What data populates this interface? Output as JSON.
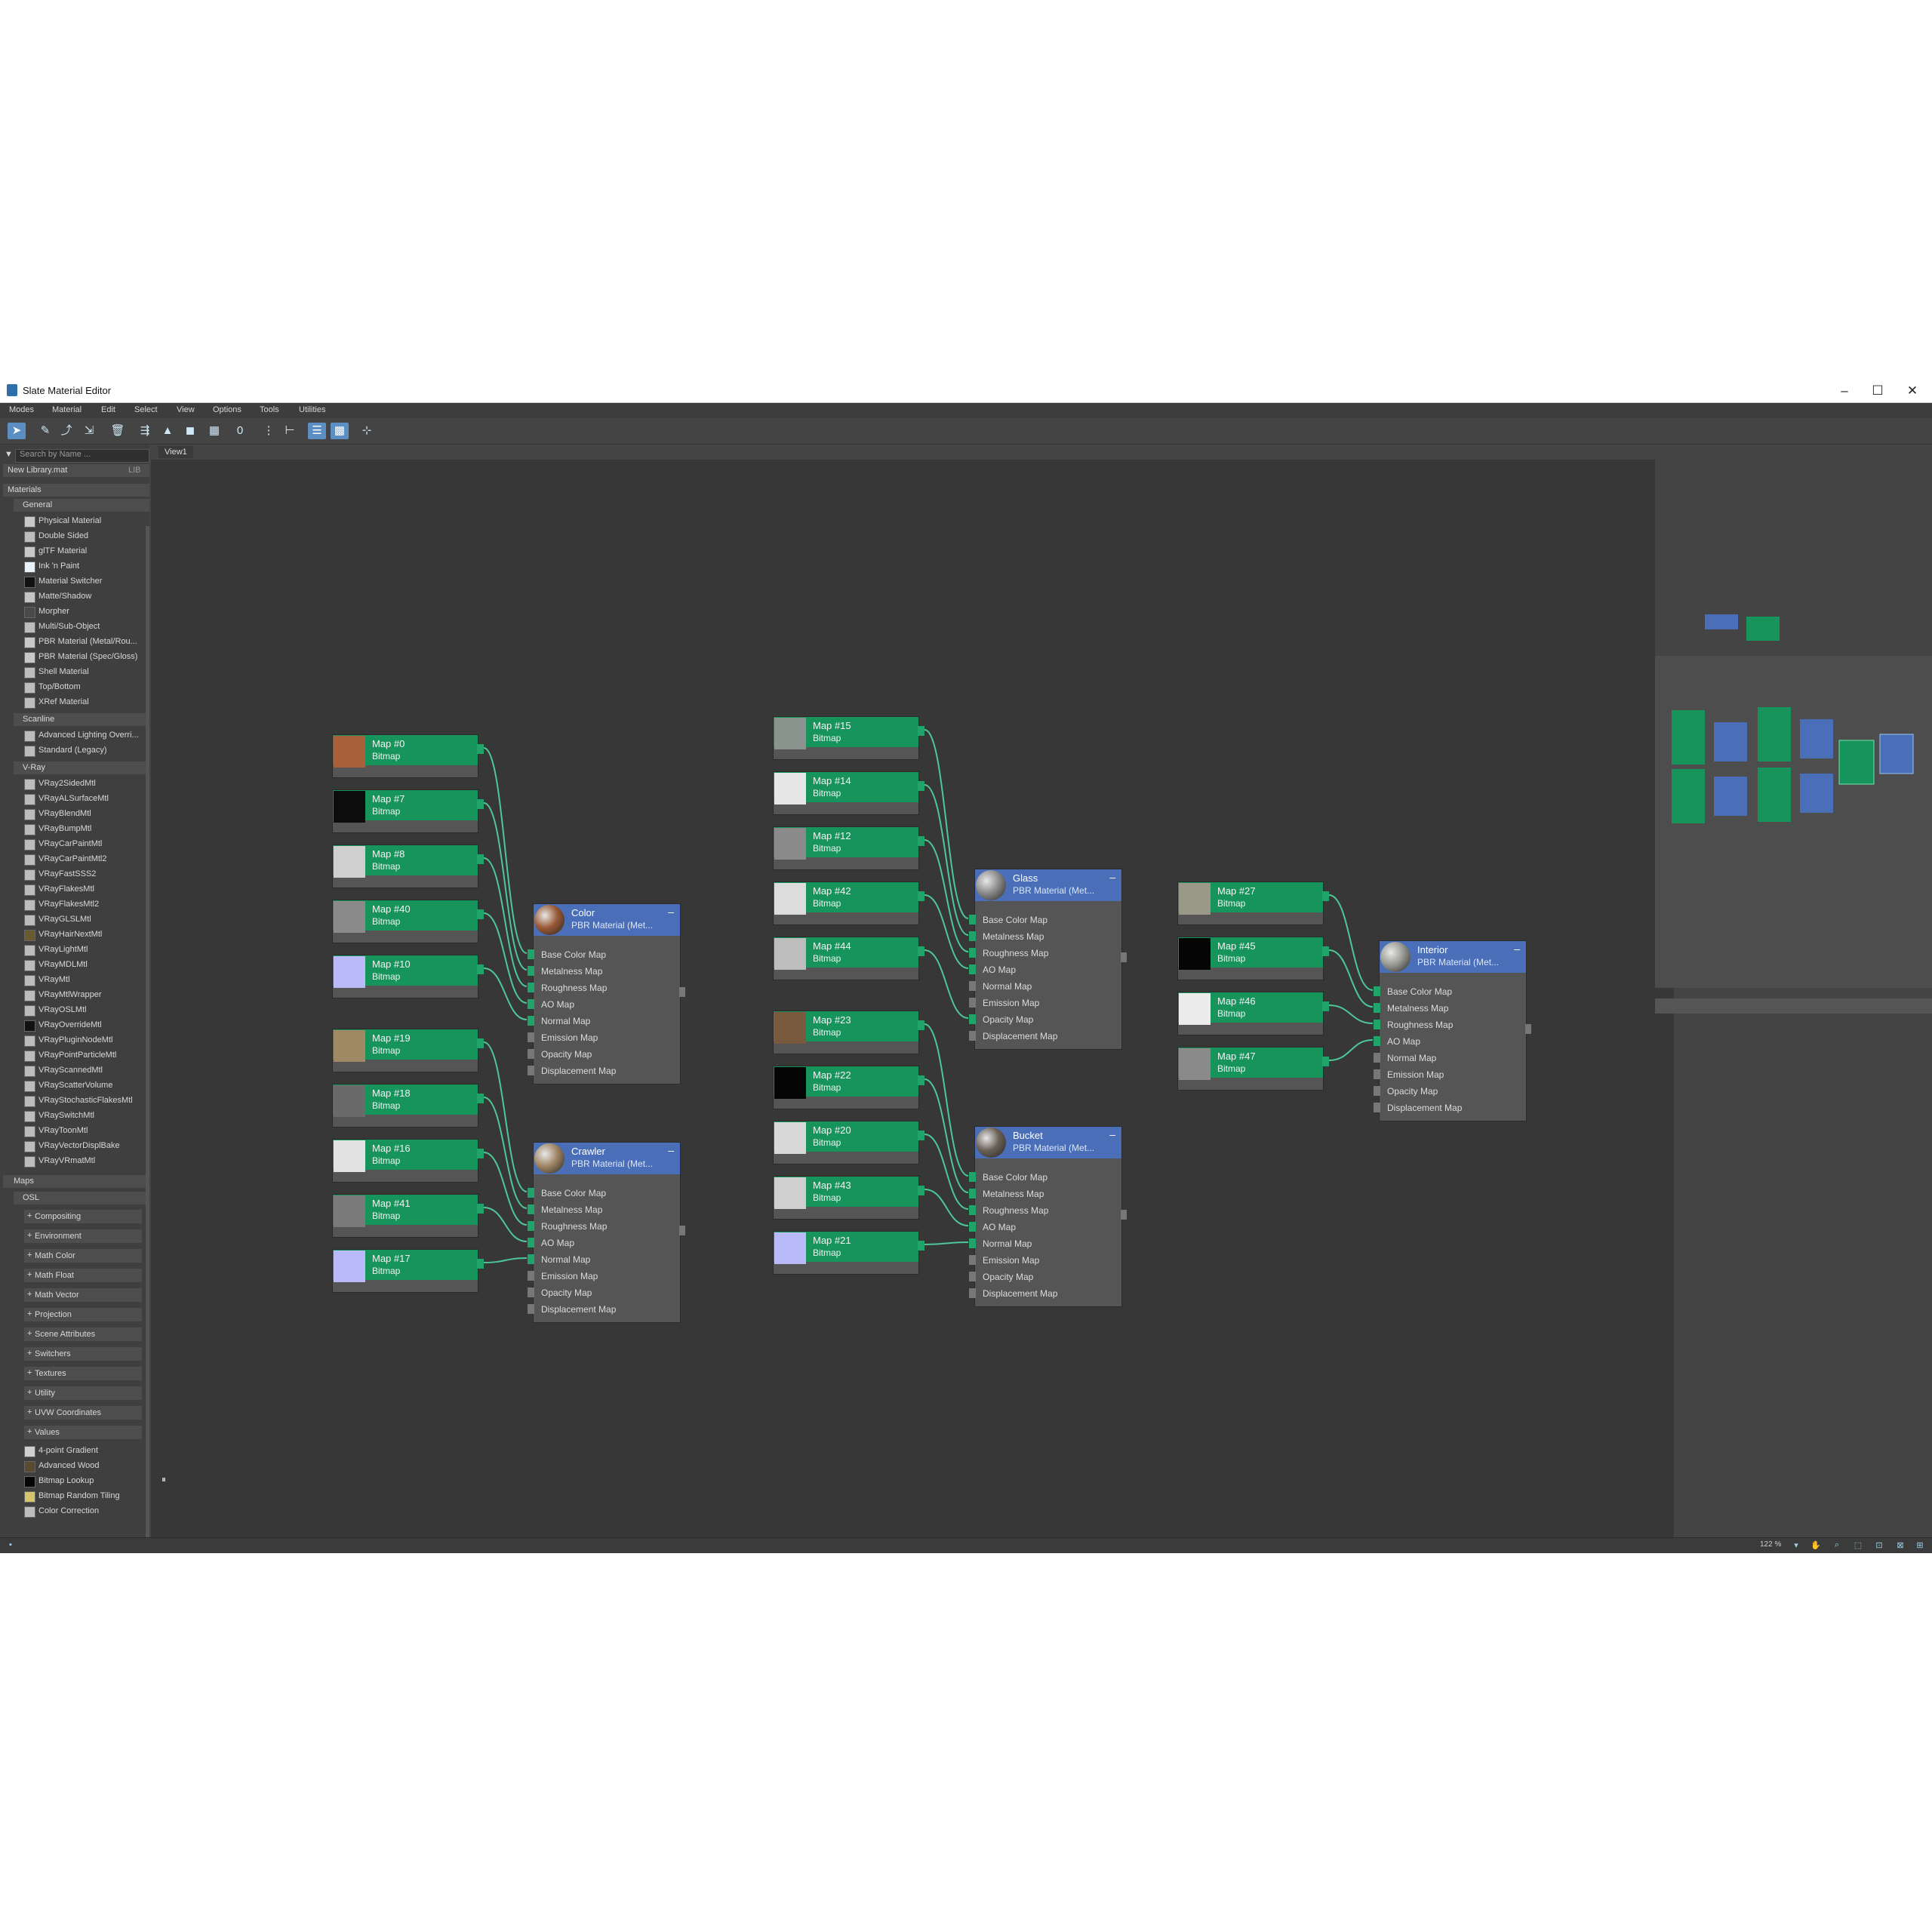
{
  "window": {
    "title": "Slate Material Editor",
    "controls": [
      "–",
      "☐",
      "✕"
    ]
  },
  "menu": [
    "Modes",
    "Material",
    "Edit",
    "Select",
    "View",
    "Options",
    "Tools",
    "Utilities"
  ],
  "toolbar_icons": [
    "select-tool-icon",
    "pick-material-icon",
    "put-to-scene-icon",
    "assign-material-icon",
    "delete-icon",
    "move-children-icon",
    "hide-unused-icon",
    "background-icon",
    "checker-icon",
    "show-map-icon",
    "layout-icon",
    "layout-children-icon",
    "params-icon",
    "material-id-icon",
    "navigator-icon"
  ],
  "browser": {
    "search_placeholder": "Search by Name ...",
    "library": "New Library.mat",
    "library_tag": "LIB",
    "materials_header": "Materials",
    "general_header": "General",
    "general": [
      "Physical Material",
      "Double Sided",
      "glTF Material",
      "Ink 'n Paint",
      "Material Switcher",
      "Matte/Shadow",
      "Morpher",
      "Multi/Sub-Object",
      "PBR Material (Metal/Rou...",
      "PBR Material (Spec/Gloss)",
      "Shell Material",
      "Top/Bottom",
      "XRef Material"
    ],
    "scanline_header": "Scanline",
    "scanline": [
      "Advanced Lighting Overri...",
      "Standard (Legacy)"
    ],
    "vray_header": "V-Ray",
    "vray": [
      "VRay2SidedMtl",
      "VRayALSurfaceMtl",
      "VRayBlendMtl",
      "VRayBumpMtl",
      "VRayCarPaintMtl",
      "VRayCarPaintMtl2",
      "VRayFastSSS2",
      "VRayFlakesMtl",
      "VRayFlakesMtl2",
      "VRayGLSLMtl",
      "VRayHairNextMtl",
      "VRayLightMtl",
      "VRayMDLMtl",
      "VRayMtl",
      "VRayMtlWrapper",
      "VRayOSLMtl",
      "VRayOverrideMtl",
      "VRayPluginNodeMtl",
      "VRayPointParticleMtl",
      "VRayScannedMtl",
      "VRayScatterVolume",
      "VRayStochasticFlakesMtl",
      "VRaySwitchMtl",
      "VRayToonMtl",
      "VRayVectorDisplBake",
      "VRayVRmatMtl"
    ],
    "maps_header": "Maps",
    "osl_header": "OSL",
    "osl": [
      "Compositing",
      "Environment",
      "Math Color",
      "Math Float",
      "Math Vector",
      "Projection",
      "Scene Attributes",
      "Switchers",
      "Textures",
      "Utility",
      "UVW Coordinates",
      "Values"
    ],
    "maps": [
      "4-point Gradient",
      "Advanced Wood",
      "Bitmap Lookup",
      "Bitmap Random Tiling",
      "Color Correction"
    ]
  },
  "view_tab": "View1",
  "slots": [
    "Base Color Map",
    "Metalness Map",
    "Roughness Map",
    "AO Map",
    "Normal Map",
    "Emission Map",
    "Opacity Map",
    "Displacement Map"
  ],
  "materials": [
    {
      "name": "Color",
      "type": "PBR Material (Met...",
      "thumb": "#9a5a36"
    },
    {
      "name": "Crawler",
      "type": "PBR Material (Met...",
      "thumb": "#a08664"
    },
    {
      "name": "Glass",
      "type": "PBR Material (Met...",
      "thumb": "#8c8c8c"
    },
    {
      "name": "Bucket",
      "type": "PBR Material (Met...",
      "thumb": "#6a6258"
    },
    {
      "name": "Interior",
      "type": "PBR Material (Met...",
      "thumb": "#9a9a94"
    }
  ],
  "maps": [
    {
      "name": "Map #0",
      "type": "Bitmap",
      "thumb": "#a8603a"
    },
    {
      "name": "Map #7",
      "type": "Bitmap",
      "thumb": "#0c0c0c"
    },
    {
      "name": "Map #8",
      "type": "Bitmap",
      "thumb": "#cfcfcf"
    },
    {
      "name": "Map #40",
      "type": "Bitmap",
      "thumb": "#8a8a8a"
    },
    {
      "name": "Map #10",
      "type": "Bitmap",
      "thumb": "#b9bbf8"
    },
    {
      "name": "Map #19",
      "type": "Bitmap",
      "thumb": "#a08a66"
    },
    {
      "name": "Map #18",
      "type": "Bitmap",
      "thumb": "#6a6a6a"
    },
    {
      "name": "Map #16",
      "type": "Bitmap",
      "thumb": "#e2e2e2"
    },
    {
      "name": "Map #41",
      "type": "Bitmap",
      "thumb": "#7a7a7a"
    },
    {
      "name": "Map #17",
      "type": "Bitmap",
      "thumb": "#b9bbf8"
    },
    {
      "name": "Map #15",
      "type": "Bitmap",
      "thumb": "#8a948e"
    },
    {
      "name": "Map #14",
      "type": "Bitmap",
      "thumb": "#e6e6e6"
    },
    {
      "name": "Map #12",
      "type": "Bitmap",
      "thumb": "#8a8a8a"
    },
    {
      "name": "Map #42",
      "type": "Bitmap",
      "thumb": "#dcdcdc"
    },
    {
      "name": "Map #44",
      "type": "Bitmap",
      "thumb": "#bdbdbd"
    },
    {
      "name": "Map #23",
      "type": "Bitmap",
      "thumb": "#7a5a3e"
    },
    {
      "name": "Map #22",
      "type": "Bitmap",
      "thumb": "#050505"
    },
    {
      "name": "Map #20",
      "type": "Bitmap",
      "thumb": "#d8d8d8"
    },
    {
      "name": "Map #43",
      "type": "Bitmap",
      "thumb": "#cfcfcf"
    },
    {
      "name": "Map #21",
      "type": "Bitmap",
      "thumb": "#b9bbf8"
    },
    {
      "name": "Map #27",
      "type": "Bitmap",
      "thumb": "#9a9888"
    },
    {
      "name": "Map #45",
      "type": "Bitmap",
      "thumb": "#050505"
    },
    {
      "name": "Map #46",
      "type": "Bitmap",
      "thumb": "#ececec"
    },
    {
      "name": "Map #47",
      "type": "Bitmap",
      "thumb": "#8a8a8a"
    }
  ],
  "status": {
    "zoom": "122 %"
  },
  "colors": {
    "map_node": "#16945c",
    "material_node": "#4a6fb8",
    "wire": "#4ec79a",
    "canvas": "#373737"
  }
}
